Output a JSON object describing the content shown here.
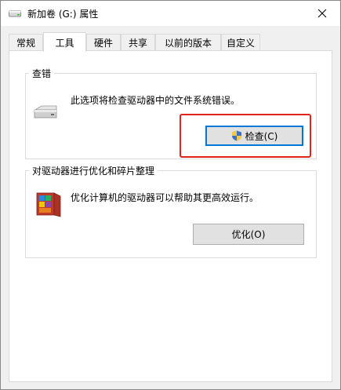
{
  "window": {
    "title": "新加卷 (G:) 属性",
    "close_symbol": "✕"
  },
  "tabs": [
    {
      "label": "常规"
    },
    {
      "label": "工具"
    },
    {
      "label": "硬件"
    },
    {
      "label": "共享"
    },
    {
      "label": "以前的版本"
    },
    {
      "label": "自定义"
    }
  ],
  "active_tab": "工具",
  "error_checking": {
    "title": "查错",
    "description": "此选项将检查驱动器中的文件系统错误。",
    "button_label": "检查(C)",
    "icon": "drive-icon"
  },
  "optimize": {
    "title": "对驱动器进行优化和碎片整理",
    "description": "优化计算机的驱动器可以帮助其更高效运行。",
    "button_label": "优化(O)",
    "icon": "defrag-icon"
  },
  "colors": {
    "highlight": "#e0231b",
    "focus": "#0078d7"
  }
}
